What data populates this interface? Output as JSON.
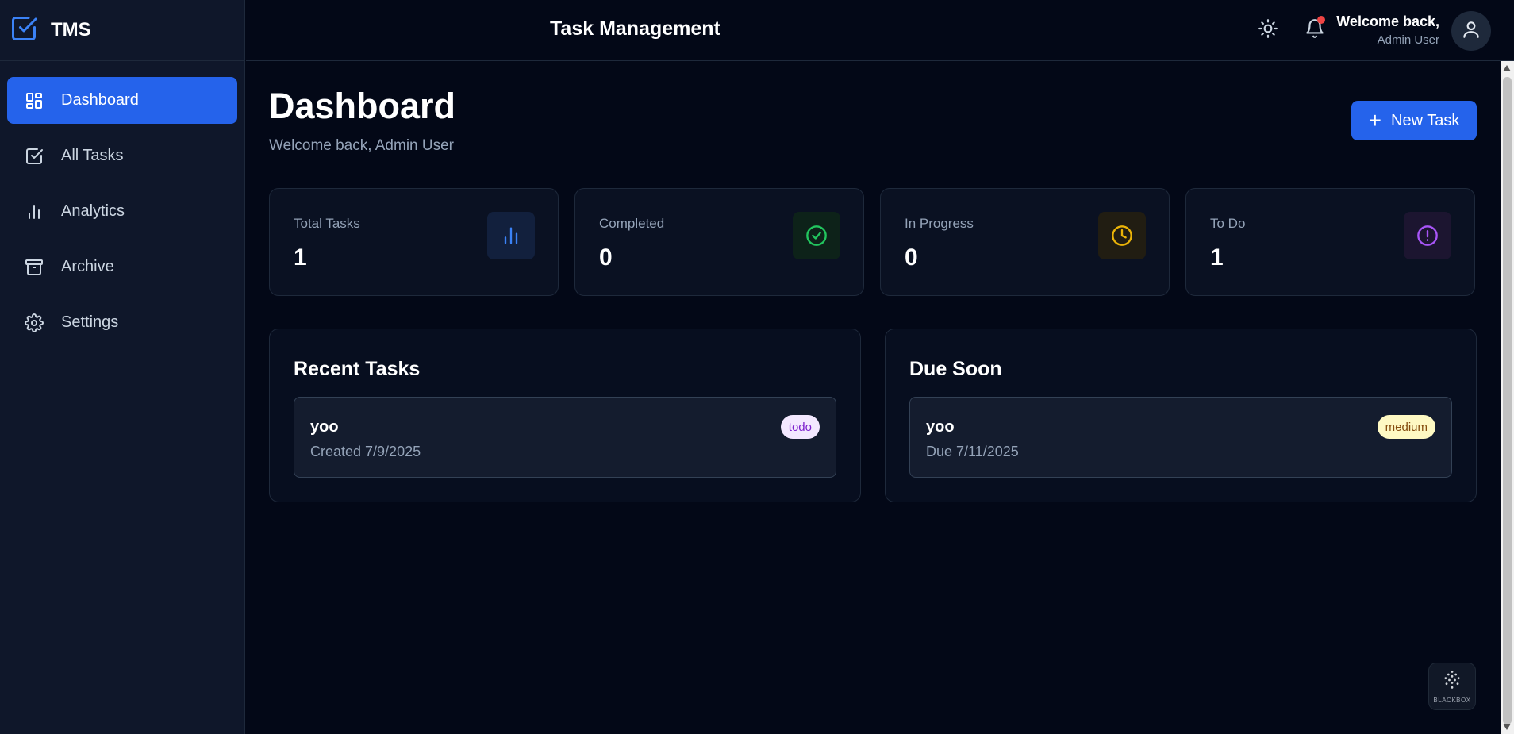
{
  "app": {
    "brand": "TMS",
    "page_heading": "Task Management"
  },
  "sidebar": {
    "items": [
      {
        "label": "Dashboard",
        "icon": "grid-icon",
        "active": true
      },
      {
        "label": "All Tasks",
        "icon": "checkbox-icon",
        "active": false
      },
      {
        "label": "Analytics",
        "icon": "bar-chart-icon",
        "active": false
      },
      {
        "label": "Archive",
        "icon": "archive-icon",
        "active": false
      },
      {
        "label": "Settings",
        "icon": "gear-icon",
        "active": false
      }
    ]
  },
  "header": {
    "greeting": "Welcome back,",
    "user_name": "Admin User",
    "theme_icon": "sun-icon",
    "notification_icon": "bell-icon"
  },
  "main": {
    "title": "Dashboard",
    "subtitle": "Welcome back, Admin User",
    "new_task_label": "New Task",
    "stats": [
      {
        "label": "Total Tasks",
        "value": "1",
        "icon": "bar-chart-icon",
        "color": "#3b82f6"
      },
      {
        "label": "Completed",
        "value": "0",
        "icon": "check-circle-icon",
        "color": "#22c55e"
      },
      {
        "label": "In Progress",
        "value": "0",
        "icon": "clock-icon",
        "color": "#eab308"
      },
      {
        "label": "To Do",
        "value": "1",
        "icon": "alert-circle-icon",
        "color": "#a855f7"
      }
    ],
    "recent_tasks": {
      "title": "Recent Tasks",
      "items": [
        {
          "name": "yoo",
          "meta": "Created 7/9/2025",
          "badge": "todo"
        }
      ]
    },
    "due_soon": {
      "title": "Due Soon",
      "items": [
        {
          "name": "yoo",
          "meta": "Due 7/11/2025",
          "badge": "medium"
        }
      ]
    }
  },
  "widget": {
    "label": "BLACKBOX"
  },
  "colors": {
    "accent": "#2563eb",
    "background": "#030817",
    "sidebar": "#0f172a"
  }
}
